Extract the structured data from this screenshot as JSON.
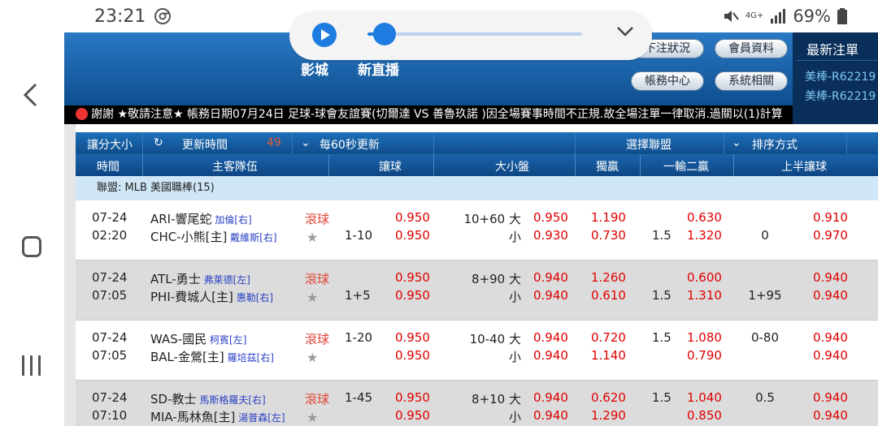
{
  "status_bar": {
    "time": "23:21",
    "battery": "69%",
    "network": "4G+"
  },
  "header": {
    "brands": [
      "影城",
      "新直播"
    ],
    "buttons": [
      "下注狀況",
      "會員資料",
      "帳務中心",
      "系統相關"
    ]
  },
  "media": {
    "progress": 0.05
  },
  "latest_panel": {
    "title": "最新注單",
    "items": [
      "美棒-R62219",
      "美棒-R62219"
    ]
  },
  "marquee": {
    "text": "謝謝 ★敬請注意★ 帳務日期07月24日 足球-球會友誼賽(切爾達 VS 善魯玖諾 )因全場賽事時間不正規.故全場注單一律取消.過關以(1)計算"
  },
  "toolbar": {
    "handicap_type": "讓分大小",
    "refresh_label": "更新時間",
    "countdown": "49",
    "interval": "每60秒更新",
    "select_league": "選擇聯盟",
    "sort": "排序方式"
  },
  "columns": [
    "時間",
    "主客隊伍",
    "讓球",
    "大小盤",
    "獨贏",
    "一輸二贏",
    "上半讓球"
  ],
  "league": "聯盟: MLB 美國職棒(15)",
  "matches": [
    {
      "date": "07-24",
      "time": "02:20",
      "away": "ARI-響尾蛇",
      "away_pitcher": "加倫[右]",
      "home": "CHC-小熊[主]",
      "home_pitcher": "戴維斯[右]",
      "live": "滾球",
      "hdp_line": "1-10",
      "hdp_line_row": 2,
      "hdp_odds": [
        "0.950",
        "0.950"
      ],
      "ou_line": "10+60 大",
      "ou_small": "小",
      "ou_odds": [
        "0.950",
        "0.930"
      ],
      "ml": [
        "1.190",
        "0.730"
      ],
      "ml2_line": "1.5",
      "ml2": [
        "0.630",
        "1.320"
      ],
      "h1_line": "0",
      "h1_line_row": 2,
      "h1_odds": [
        "0.910",
        "0.970"
      ]
    },
    {
      "date": "07-24",
      "time": "07:05",
      "away": "ATL-勇士",
      "away_pitcher": "弗萊德[左]",
      "home": "PHI-費城人[主]",
      "home_pitcher": "惠勒[右]",
      "live": "滾球",
      "hdp_line": "1+5",
      "hdp_line_row": 2,
      "hdp_odds": [
        "0.950",
        "0.950"
      ],
      "ou_line": "8+90 大",
      "ou_small": "小",
      "ou_odds": [
        "0.940",
        "0.940"
      ],
      "ml": [
        "1.260",
        "0.610"
      ],
      "ml2_line": "1.5",
      "ml2": [
        "0.600",
        "1.310"
      ],
      "h1_line": "1+95",
      "h1_line_row": 2,
      "h1_odds": [
        "0.940",
        "0.940"
      ]
    },
    {
      "date": "07-24",
      "time": "07:05",
      "away": "WAS-國民",
      "away_pitcher": "柯賓[左]",
      "home": "BAL-金鶯[主]",
      "home_pitcher": "羅培茲[右]",
      "live": "滾球",
      "hdp_line": "1-20",
      "hdp_line_row": 1,
      "hdp_odds": [
        "0.950",
        "0.950"
      ],
      "ou_line": "10-40 大",
      "ou_small": "小",
      "ou_odds": [
        "0.940",
        "0.940"
      ],
      "ml": [
        "0.720",
        "1.140"
      ],
      "ml2_line": "1.5",
      "ml2": [
        "1.080",
        "0.790"
      ],
      "h1_line": "0-80",
      "h1_line_row": 1,
      "h1_odds": [
        "0.940",
        "0.940"
      ]
    },
    {
      "date": "07-24",
      "time": "07:10",
      "away": "SD-教士",
      "away_pitcher": "馬斯格羅夫[右]",
      "home": "MIA-馬林魚[主]",
      "home_pitcher": "湯普森[左]",
      "live": "滾球",
      "hdp_line": "1-45",
      "hdp_line_row": 1,
      "hdp_odds": [
        "0.950",
        "0.950"
      ],
      "ou_line": "8+10 大",
      "ou_small": "小",
      "ou_odds": [
        "0.940",
        "0.940"
      ],
      "ml": [
        "0.620",
        "1.290"
      ],
      "ml2_line": "1.5",
      "ml2": [
        "1.040",
        "0.850"
      ],
      "h1_line": "0.5",
      "h1_line_row": 1,
      "h1_odds": [
        "0.940",
        "0.940"
      ]
    }
  ]
}
